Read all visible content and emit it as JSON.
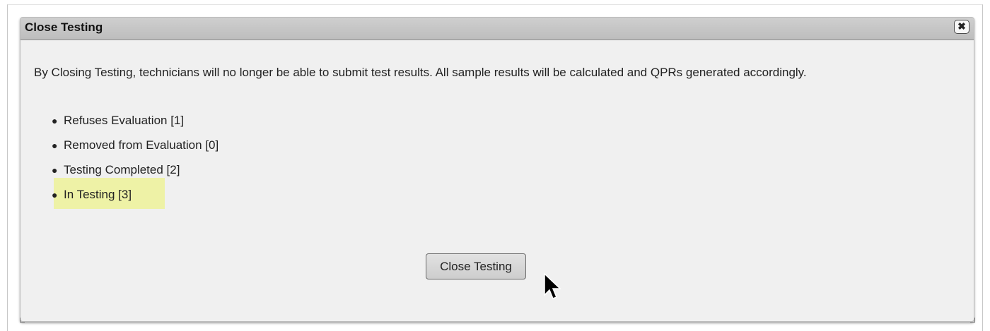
{
  "dialog": {
    "title": "Close Testing",
    "close_icon_glyph": "✖",
    "message": "By Closing Testing, technicians will no longer be able to submit test results. All sample results will be calculated and QPRs generated accordingly.",
    "status_items": [
      {
        "label": "Refuses Evaluation [1]"
      },
      {
        "label": "Removed from Evaluation [0]"
      },
      {
        "label": "Testing Completed [2]"
      },
      {
        "label": "In Testing [3]"
      }
    ],
    "highlighted_item_index": 3,
    "action_button_label": "Close Testing"
  },
  "colors": {
    "titlebar": "#c6c6c6",
    "dialog_background": "#f0f0f0",
    "highlight": "#eef2a6"
  },
  "icons": {
    "close": "close-icon",
    "cursor": "mouse-pointer-icon",
    "bullet": "bullet-icon"
  }
}
